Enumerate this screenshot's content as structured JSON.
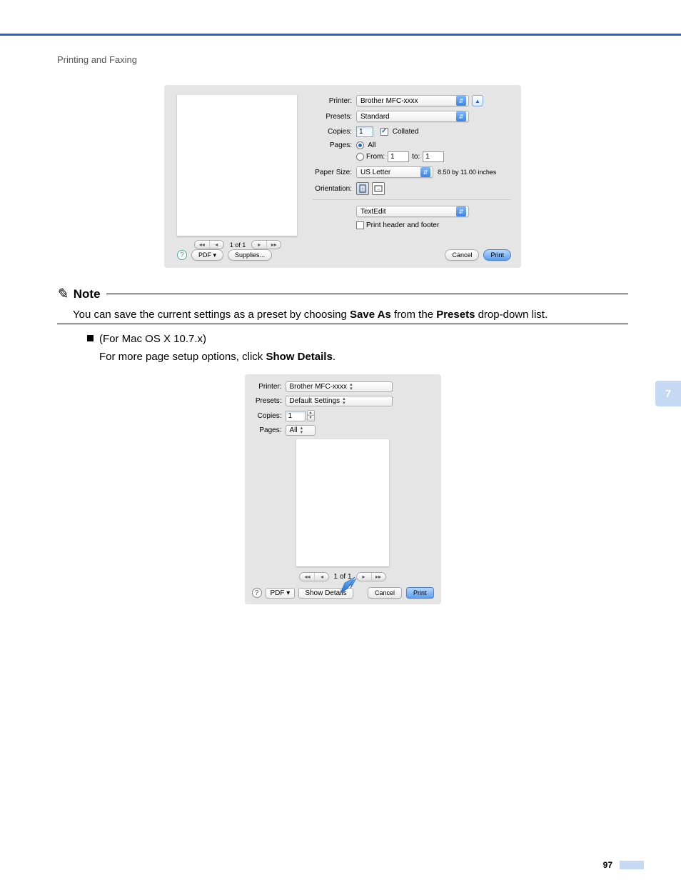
{
  "breadcrumb": "Printing and Faxing",
  "dialog1": {
    "printer_label": "Printer:",
    "printer_value": "Brother MFC-xxxx",
    "presets_label": "Presets:",
    "presets_value": "Standard",
    "copies_label": "Copies:",
    "copies_value": "1",
    "collated_label": "Collated",
    "pages_label": "Pages:",
    "pages_all": "All",
    "pages_from": "From:",
    "pages_from_value": "1",
    "pages_to": "to:",
    "pages_to_value": "1",
    "paper_size_label": "Paper Size:",
    "paper_size_value": "US Letter",
    "paper_size_dim": "8.50 by 11.00 inches",
    "orientation_label": "Orientation:",
    "section_select": "TextEdit",
    "print_header_footer": "Print header and footer",
    "page_nav": "1 of 1",
    "pdf_btn": "PDF ▾",
    "supplies_btn": "Supplies...",
    "cancel_btn": "Cancel",
    "print_btn": "Print"
  },
  "note": {
    "title": "Note",
    "body_pre": "You can save the current settings as a preset by choosing ",
    "body_bold1": "Save As",
    "body_mid": " from the ",
    "body_bold2": "Presets",
    "body_post": " drop-down list."
  },
  "section2": {
    "heading": "(For Mac OS X 10.7.x)",
    "body_pre": "For more page setup options, click ",
    "body_bold": "Show Details",
    "body_post": "."
  },
  "dialog2": {
    "printer_label": "Printer:",
    "printer_value": "Brother MFC-xxxx",
    "presets_label": "Presets:",
    "presets_value": "Default Settings",
    "copies_label": "Copies:",
    "copies_value": "1",
    "pages_label": "Pages:",
    "pages_value": "All",
    "page_nav": "1 of 1",
    "pdf_btn": "PDF ▾",
    "show_details_btn": "Show Details",
    "cancel_btn": "Cancel",
    "print_btn": "Print"
  },
  "side_tab": "7",
  "page_number": "97"
}
